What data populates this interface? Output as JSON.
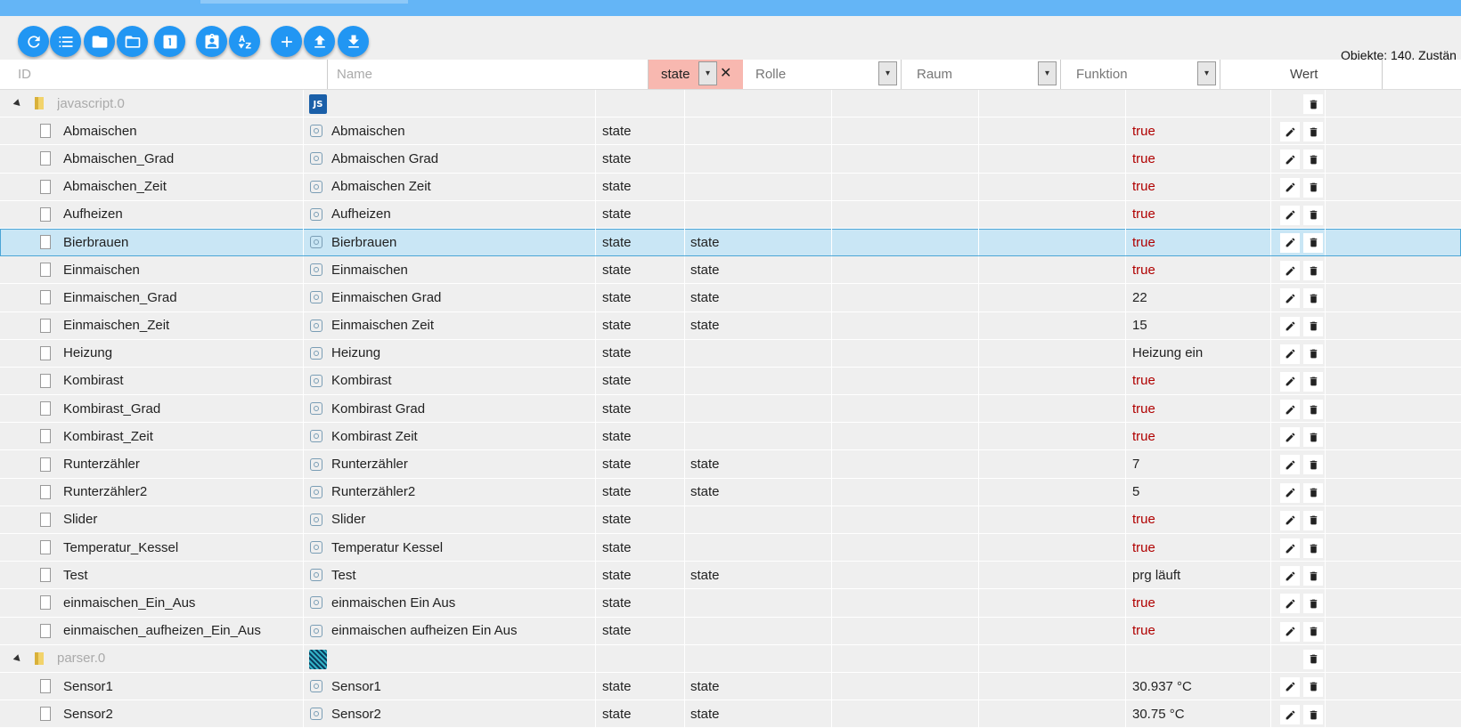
{
  "toolbar": {
    "buttons": [
      {
        "name": "refresh",
        "icon": "refresh-icon"
      },
      {
        "name": "list-view",
        "icon": "list-icon"
      },
      {
        "name": "collapse-folders",
        "icon": "folder-icon"
      },
      {
        "name": "expand-folders",
        "icon": "folder-open-icon"
      },
      {
        "name": "expand-level",
        "icon": "number-one-icon",
        "label": "1"
      },
      {
        "name": "custom-settings",
        "icon": "contact-card-icon"
      },
      {
        "name": "sort-az",
        "icon": "sort-az-icon",
        "label": "AZ"
      },
      {
        "name": "add-object",
        "icon": "plus-icon"
      },
      {
        "name": "upload",
        "icon": "upload-icon"
      },
      {
        "name": "download",
        "icon": "download-icon"
      }
    ],
    "object_count": "Objekte: 140, Zustän"
  },
  "header": {
    "id_placeholder": "ID",
    "name_placeholder": "Name",
    "type_filter": "state",
    "role_label": "Rolle",
    "room_label": "Raum",
    "function_label": "Funktion",
    "value_label": "Wert"
  },
  "rows": [
    {
      "group": true,
      "id": "javascript.0",
      "badge": "JS",
      "kind": "js"
    },
    {
      "id": "Abmaischen",
      "name": "Abmaischen",
      "type": "state",
      "role": "",
      "value": "true",
      "vtype": "bool"
    },
    {
      "id": "Abmaischen_Grad",
      "name": "Abmaischen Grad",
      "type": "state",
      "role": "",
      "value": "true",
      "vtype": "bool"
    },
    {
      "id": "Abmaischen_Zeit",
      "name": "Abmaischen Zeit",
      "type": "state",
      "role": "",
      "value": "true",
      "vtype": "bool"
    },
    {
      "id": "Aufheizen",
      "name": "Aufheizen",
      "type": "state",
      "role": "",
      "value": "true",
      "vtype": "bool"
    },
    {
      "id": "Bierbrauen",
      "name": "Bierbrauen",
      "type": "state",
      "role": "state",
      "value": "true",
      "vtype": "bool",
      "selected": true
    },
    {
      "id": "Einmaischen",
      "name": "Einmaischen",
      "type": "state",
      "role": "state",
      "value": "true",
      "vtype": "bool"
    },
    {
      "id": "Einmaischen_Grad",
      "name": "Einmaischen Grad",
      "type": "state",
      "role": "state",
      "value": "22",
      "vtype": "text"
    },
    {
      "id": "Einmaischen_Zeit",
      "name": "Einmaischen Zeit",
      "type": "state",
      "role": "state",
      "value": "15",
      "vtype": "text"
    },
    {
      "id": "Heizung",
      "name": "Heizung",
      "type": "state",
      "role": "",
      "value": "Heizung ein",
      "vtype": "text"
    },
    {
      "id": "Kombirast",
      "name": "Kombirast",
      "type": "state",
      "role": "",
      "value": "true",
      "vtype": "bool"
    },
    {
      "id": "Kombirast_Grad",
      "name": "Kombirast Grad",
      "type": "state",
      "role": "",
      "value": "true",
      "vtype": "bool"
    },
    {
      "id": "Kombirast_Zeit",
      "name": "Kombirast Zeit",
      "type": "state",
      "role": "",
      "value": "true",
      "vtype": "bool"
    },
    {
      "id": "Runterzähler",
      "name": "Runterzähler",
      "type": "state",
      "role": "state",
      "value": "7",
      "vtype": "text"
    },
    {
      "id": "Runterzähler2",
      "name": "Runterzähler2",
      "type": "state",
      "role": "state",
      "value": "5",
      "vtype": "text"
    },
    {
      "id": "Slider",
      "name": "Slider",
      "type": "state",
      "role": "",
      "value": "true",
      "vtype": "bool"
    },
    {
      "id": "Temperatur_Kessel",
      "name": "Temperatur Kessel",
      "type": "state",
      "role": "",
      "value": "true",
      "vtype": "bool"
    },
    {
      "id": "Test",
      "name": "Test",
      "type": "state",
      "role": "state",
      "value": "prg läuft",
      "vtype": "text"
    },
    {
      "id": "einmaischen_Ein_Aus",
      "name": "einmaischen Ein Aus",
      "type": "state",
      "role": "",
      "value": "true",
      "vtype": "bool"
    },
    {
      "id": "einmaischen_aufheizen_Ein_Aus",
      "name": "einmaischen aufheizen Ein Aus",
      "type": "state",
      "role": "",
      "value": "true",
      "vtype": "bool"
    },
    {
      "group": true,
      "id": "parser.0",
      "badge": "",
      "kind": "parser"
    },
    {
      "id": "Sensor1",
      "name": "Sensor1",
      "type": "state",
      "role": "state",
      "value": "30.937 °C",
      "vtype": "text"
    },
    {
      "id": "Sensor2",
      "name": "Sensor2",
      "type": "state",
      "role": "state",
      "value": "30.75 °C",
      "vtype": "text"
    }
  ],
  "colors": {
    "accent": "#2196f3",
    "topbar": "#64b5f6",
    "bool_value": "#b00000",
    "filter_active": "#f8b8b0",
    "selected_row": "#c9e6f5"
  }
}
